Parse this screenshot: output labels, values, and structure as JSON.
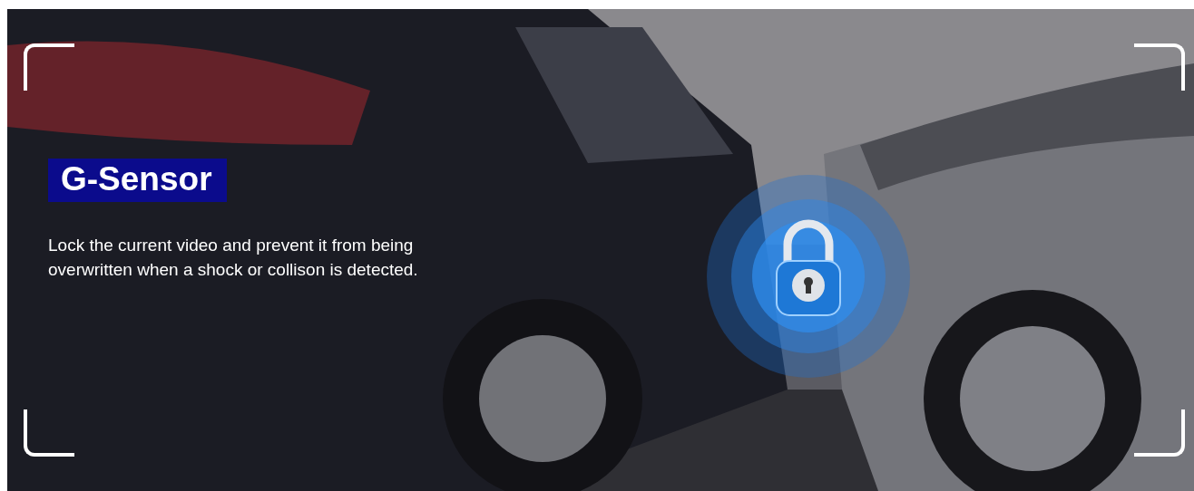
{
  "banner": {
    "title": "G-Sensor",
    "description": "Lock the current video and prevent it from being overwritten when a shock or collison is detected."
  }
}
